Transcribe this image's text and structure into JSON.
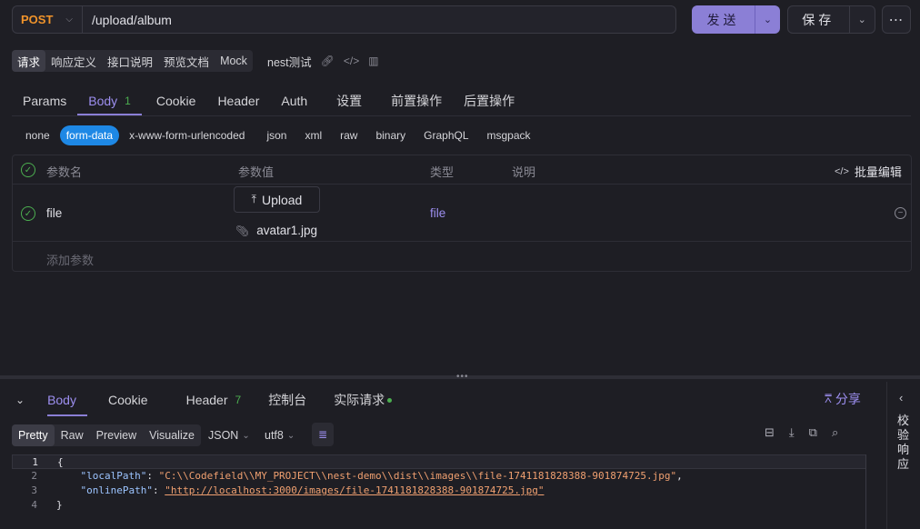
{
  "request": {
    "method": "POST",
    "url": "/upload/album",
    "send_label": "发送",
    "save_label": "保存"
  },
  "mode_tabs": [
    "请求",
    "响应定义",
    "接口说明",
    "预览文档",
    "Mock"
  ],
  "mode_extra": "nest测试",
  "req_tabs": {
    "params": "Params",
    "body": "Body",
    "body_count": "1",
    "cookie": "Cookie",
    "header": "Header",
    "auth": "Auth",
    "settings": "设置",
    "pre": "前置操作",
    "post": "后置操作"
  },
  "body_types": [
    "none",
    "form-data",
    "x-www-form-urlencoded",
    "json",
    "xml",
    "raw",
    "binary",
    "GraphQL",
    "msgpack"
  ],
  "params_table": {
    "headers": {
      "name": "参数名",
      "value": "参数值",
      "type": "类型",
      "desc": "说明",
      "bulk": "批量编辑"
    },
    "row": {
      "name": "file",
      "upload": "Upload",
      "file_name": "avatar1.jpg",
      "type": "file"
    },
    "add_placeholder": "添加参数"
  },
  "response": {
    "tabs": {
      "body": "Body",
      "cookie": "Cookie",
      "header": "Header",
      "header_count": "7",
      "console": "控制台",
      "actual": "实际请求"
    },
    "share": "分享",
    "side_label": "校验响应",
    "view_tabs": [
      "Pretty",
      "Raw",
      "Preview",
      "Visualize"
    ],
    "format": "JSON",
    "encoding": "utf8",
    "code": {
      "line_numbers": [
        "1",
        "2",
        "3",
        "4"
      ],
      "open": "{",
      "k1": "\"localPath\"",
      "v1": "\"C:\\\\Codefield\\\\MY_PROJECT\\\\nest-demo\\\\dist\\\\images\\\\file-1741181828388-901874725.jpg\"",
      "k2": "\"onlinePath\"",
      "v2": "\"http://localhost:3000/images/file-1741181828388-901874725.jpg\"",
      "close": "}"
    }
  },
  "colors": {
    "accent": "#8b7fd6",
    "method": "#f0932b",
    "form_data_active": "#1e88e5",
    "success": "#4caf50"
  }
}
